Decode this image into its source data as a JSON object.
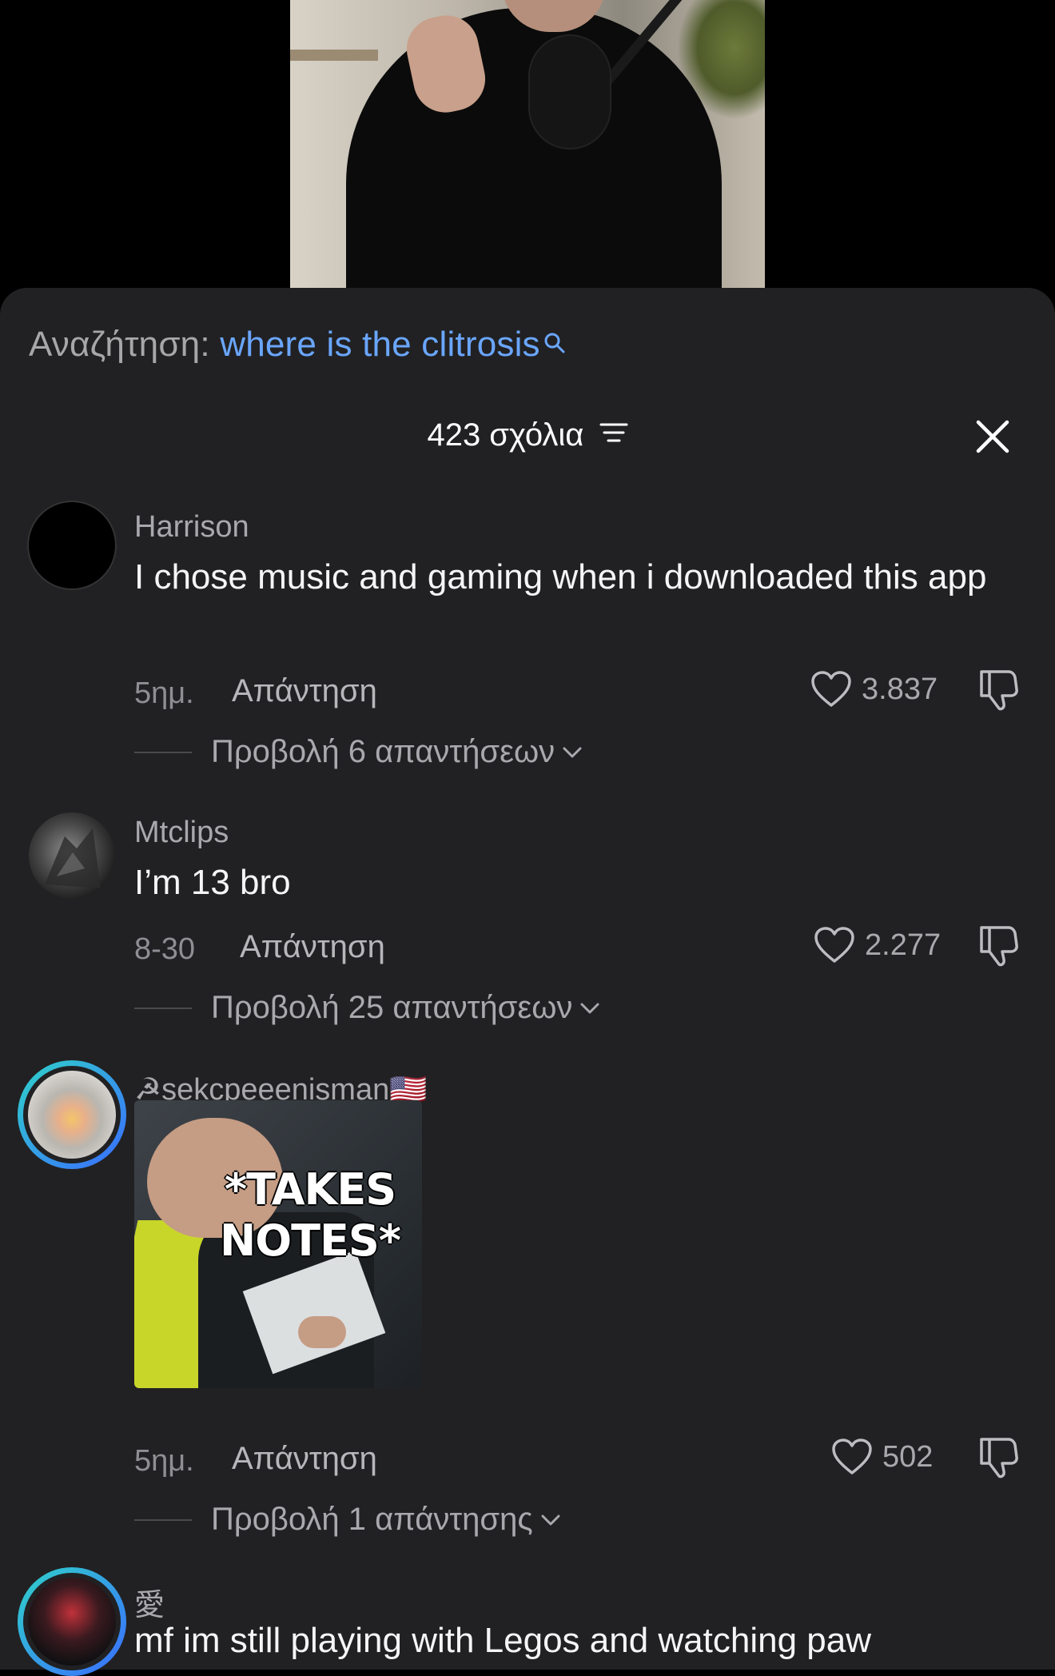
{
  "search": {
    "prefix": "Αναζήτηση:",
    "term": "where is the clitrosis"
  },
  "header": {
    "count_label": "423 σχόλια"
  },
  "comments": [
    {
      "username": "Harrison",
      "text": "I chose music and gaming when i downloaded this app",
      "time": "5ημ.",
      "reply_label": "Απάντηση",
      "likes": "3.837",
      "view_replies": "Προβολή 6 απαντήσεων"
    },
    {
      "username": "Mtclips",
      "text": "I’m 13 bro",
      "time": "8-30",
      "reply_label": "Απάντηση",
      "likes": "2.277",
      "view_replies": "Προβολή 25 απαντήσεων"
    },
    {
      "username": "☭sekcpeeenisman🇺🇸",
      "gif_caption": "*TAKES NOTES*",
      "time": "5ημ.",
      "reply_label": "Απάντηση",
      "likes": "502",
      "view_replies": "Προβολή 1 απάντησης"
    },
    {
      "username": "愛",
      "text": "mf im still playing with Legos and watching paw"
    }
  ],
  "colors": {
    "sheet_bg": "#212123",
    "accent_link": "#6aa6ff",
    "story_ring_start": "#2fd2c9",
    "story_ring_end": "#3a6cff"
  }
}
